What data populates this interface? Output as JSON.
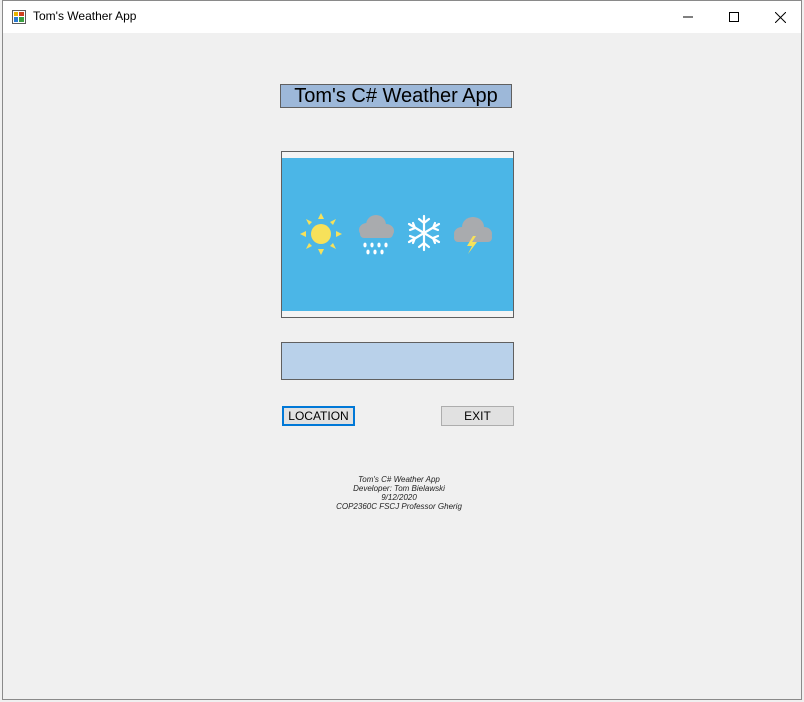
{
  "window": {
    "title": "Tom's Weather App",
    "controls": {
      "minimize_icon": "minimize-icon",
      "maximize_icon": "maximize-icon",
      "close_icon": "close-icon"
    }
  },
  "form": {
    "heading": "Tom's C# Weather App",
    "weather_icons": [
      "sun-icon",
      "rain-cloud-icon",
      "snowflake-icon",
      "thunder-cloud-icon"
    ],
    "output_text": "",
    "buttons": {
      "location": "LOCATION",
      "exit": "EXIT"
    },
    "credits": [
      "Tom's C# Weather App",
      "Developer: Tom Bielawski",
      "9/12/2020",
      "COP2360C FSCJ Professor Gherig"
    ]
  },
  "colors": {
    "sky": "#4bb6e7",
    "heading_bg": "#9db8d9",
    "output_bg": "#b9d1ea",
    "focus_border": "#0078d7"
  }
}
